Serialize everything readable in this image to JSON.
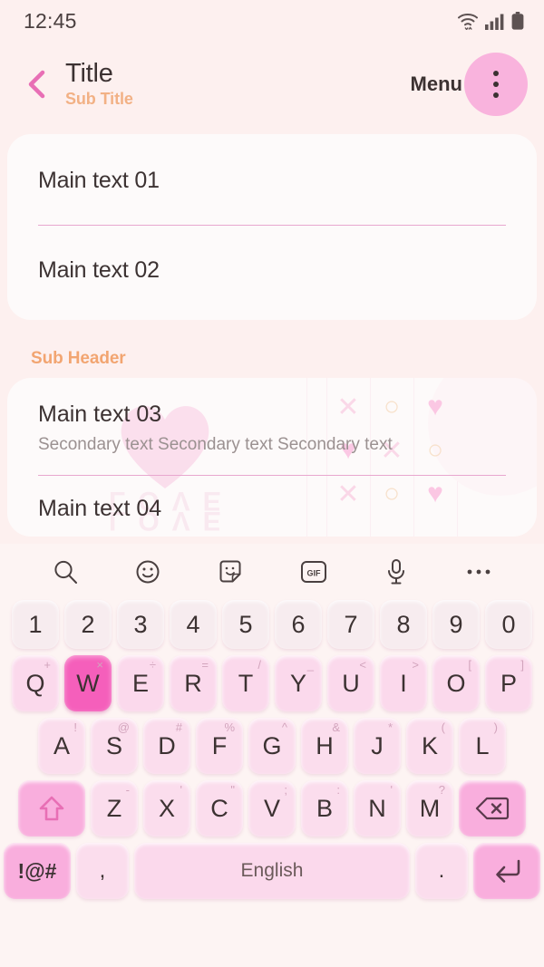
{
  "status_bar": {
    "time": "12:45",
    "icons": [
      "wifi-icon",
      "cellular-signal-icon",
      "battery-icon"
    ]
  },
  "header": {
    "back_icon": "chevron-left-icon",
    "title": "Title",
    "subtitle": "Sub Title",
    "menu_label": "Menu",
    "menu_icon": "overflow-menu-icon"
  },
  "colors": {
    "background": "#fdf0ef",
    "card": "#fdfafa",
    "accent_pink": "#f9b3dd",
    "divider_pink": "#e8a7cf",
    "accent_peach": "#f2a571",
    "key_pink": "#fbd9ec",
    "key_active": "#f55fbb",
    "key_function": "#f9aedd",
    "text_primary": "#3c3232",
    "text_secondary": "#9b9191"
  },
  "list": {
    "card_one": [
      {
        "main": "Main text 01"
      },
      {
        "main": "Main text 02"
      }
    ],
    "sub_header": "Sub Header",
    "card_two": [
      {
        "main": "Main text 03",
        "secondary": "Secondary text Secondary text Secondary text"
      },
      {
        "main": "Main text 04"
      }
    ]
  },
  "decoration": {
    "love_text": "LOVE",
    "glyphs": [
      "×",
      "○",
      "♥"
    ]
  },
  "keyboard": {
    "toolbar": [
      {
        "name": "search-icon"
      },
      {
        "name": "emoji-icon"
      },
      {
        "name": "sticker-icon"
      },
      {
        "name": "gif-icon",
        "label": "GIF"
      },
      {
        "name": "microphone-icon"
      },
      {
        "name": "more-options-icon"
      }
    ],
    "number_row": [
      "1",
      "2",
      "3",
      "4",
      "5",
      "6",
      "7",
      "8",
      "9",
      "0"
    ],
    "row_q": [
      {
        "key": "Q",
        "sup": "+"
      },
      {
        "key": "W",
        "sup": "×",
        "active": true
      },
      {
        "key": "E",
        "sup": "÷"
      },
      {
        "key": "R",
        "sup": "="
      },
      {
        "key": "T",
        "sup": "/"
      },
      {
        "key": "Y",
        "sup": "_"
      },
      {
        "key": "U",
        "sup": "<"
      },
      {
        "key": "I",
        "sup": ">"
      },
      {
        "key": "O",
        "sup": "["
      },
      {
        "key": "P",
        "sup": "]"
      }
    ],
    "row_a": [
      {
        "key": "A",
        "sup": "!"
      },
      {
        "key": "S",
        "sup": "@"
      },
      {
        "key": "D",
        "sup": "#"
      },
      {
        "key": "F",
        "sup": "%"
      },
      {
        "key": "G",
        "sup": "^"
      },
      {
        "key": "H",
        "sup": "&"
      },
      {
        "key": "J",
        "sup": "*"
      },
      {
        "key": "K",
        "sup": "("
      },
      {
        "key": "L",
        "sup": ")"
      }
    ],
    "row_z": [
      {
        "key": "Z",
        "sup": "-"
      },
      {
        "key": "X",
        "sup": "'"
      },
      {
        "key": "C",
        "sup": "\""
      },
      {
        "key": "V",
        "sup": ";"
      },
      {
        "key": "B",
        "sup": ":"
      },
      {
        "key": "N",
        "sup": "'"
      },
      {
        "key": "M",
        "sup": "?"
      }
    ],
    "shift_icon": "shift-arrow-icon",
    "backspace_icon": "backspace-icon",
    "bottom_row": {
      "symbols_label": "!@#",
      "comma_label": ",",
      "space_label": "English",
      "period_label": ".",
      "enter_icon": "enter-return-icon"
    }
  }
}
